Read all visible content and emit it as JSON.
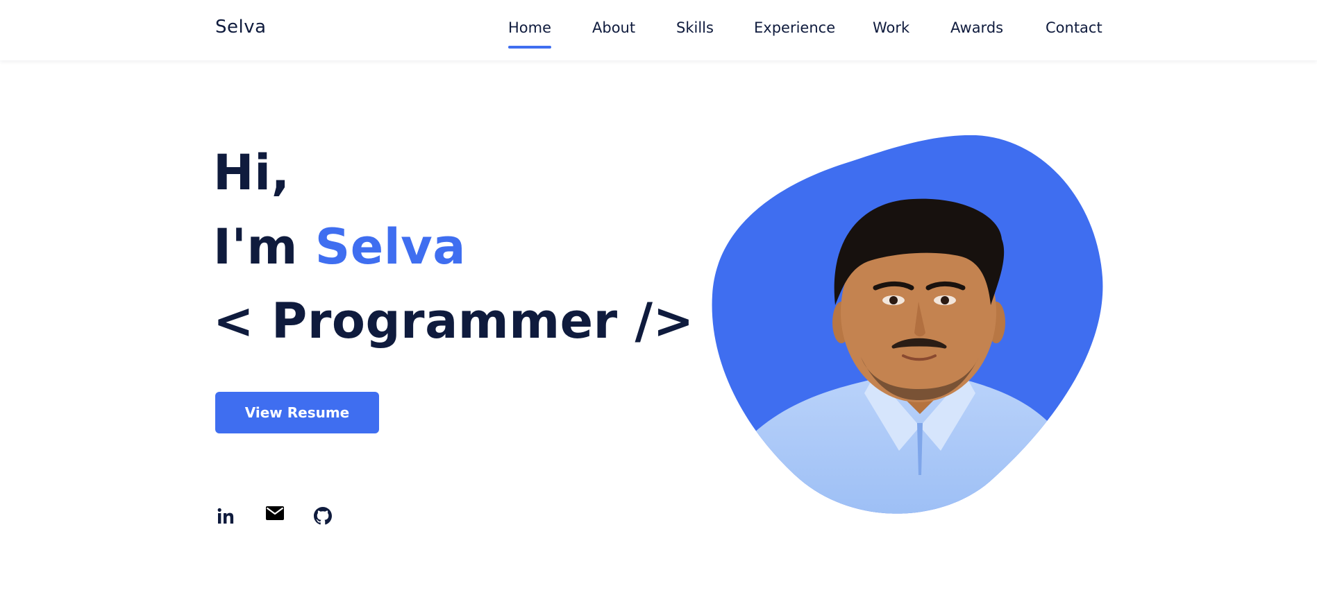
{
  "header": {
    "brand": "Selva",
    "nav": [
      {
        "label": "Home",
        "active": true
      },
      {
        "label": "About",
        "active": false
      },
      {
        "label": "Skills",
        "active": false
      },
      {
        "label": "Experience",
        "active": false
      },
      {
        "label": "Work",
        "active": false
      },
      {
        "label": "Awards",
        "active": false
      },
      {
        "label": "Contact",
        "active": false
      }
    ]
  },
  "hero": {
    "greeting": "Hi,",
    "intro_prefix": "I'm",
    "name": "Selva",
    "role": "< Programmer />",
    "resume_button": "View Resume"
  },
  "social": [
    {
      "icon": "linkedin-icon"
    },
    {
      "icon": "mail-icon"
    },
    {
      "icon": "github-icon"
    }
  ],
  "colors": {
    "accent": "#3f6ef0",
    "text": "#0f1b3d",
    "shirt": "#a9c6f7"
  }
}
